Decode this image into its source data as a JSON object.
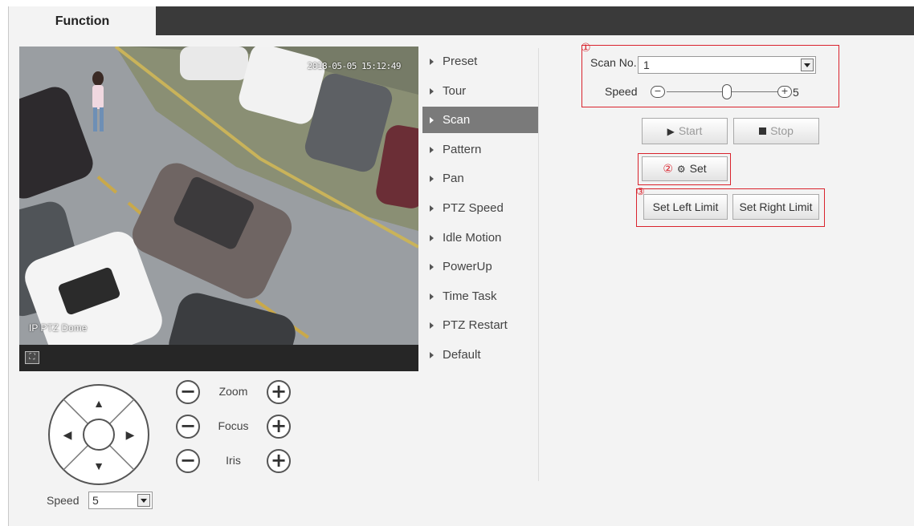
{
  "header": {
    "tab_label": "Function"
  },
  "video": {
    "timestamp": "2018-05-05 15:12:49",
    "osd_name": "IP PTZ Dome"
  },
  "ptz": {
    "zoom_label": "Zoom",
    "focus_label": "Focus",
    "iris_label": "Iris",
    "speed_label": "Speed",
    "speed_value": "5"
  },
  "menu": {
    "items": [
      {
        "label": "Preset"
      },
      {
        "label": "Tour"
      },
      {
        "label": "Scan"
      },
      {
        "label": "Pattern"
      },
      {
        "label": "Pan"
      },
      {
        "label": "PTZ Speed"
      },
      {
        "label": "Idle Motion"
      },
      {
        "label": "PowerUp"
      },
      {
        "label": "Time Task"
      },
      {
        "label": "PTZ Restart"
      },
      {
        "label": "Default"
      }
    ],
    "active": "Scan"
  },
  "scan": {
    "badge1": "①",
    "badge2": "②",
    "badge3": "③",
    "scan_no_label": "Scan No.",
    "scan_no_value": "1",
    "speed_label": "Speed",
    "speed_value": "5",
    "speed_fraction": 0.5,
    "start_label": "Start",
    "stop_label": "Stop",
    "set_label": "Set",
    "set_left_label": "Set Left Limit",
    "set_right_label": "Set Right Limit"
  },
  "colors": {
    "annotation_red": "#d9232d",
    "header_bar": "#3a3a3a",
    "menu_active": "#7a7a7a"
  }
}
